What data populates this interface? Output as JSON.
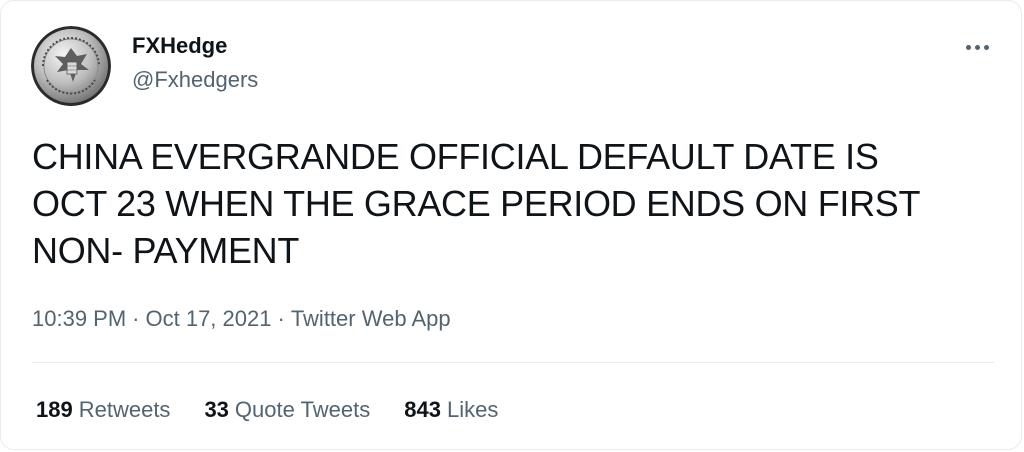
{
  "tweet": {
    "author": {
      "name": "FXHedge",
      "handle": "@Fxhedgers",
      "avatar_icon": "silver-eagle-coin-icon"
    },
    "more_icon": "more-horizontal-icon",
    "text_lines": [
      "CHINA EVERGRANDE OFFICIAL DEFAULT DATE IS",
      "OCT 23 WHEN THE GRACE PERIOD ENDS ON FIRST",
      "NON- PAYMENT"
    ],
    "time": "10:39 PM",
    "separator": "·",
    "date": "Oct 17, 2021",
    "source": "Twitter Web App",
    "stats": [
      {
        "count": "189",
        "label": "Retweets"
      },
      {
        "count": "33",
        "label": "Quote Tweets"
      },
      {
        "count": "843",
        "label": "Likes"
      }
    ]
  },
  "colors": {
    "text_primary": "#0f1419",
    "text_secondary": "#536471",
    "border": "#e6ecf0"
  }
}
